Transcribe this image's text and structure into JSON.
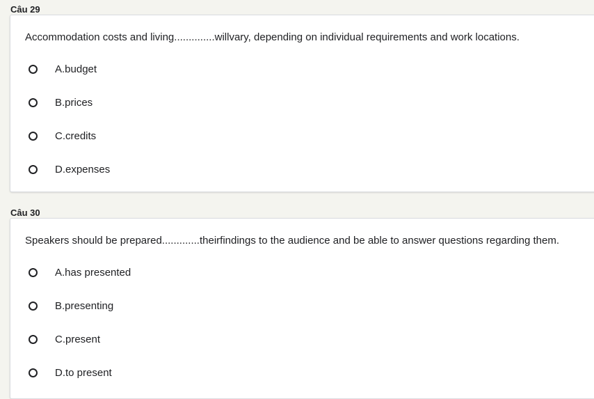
{
  "questions": [
    {
      "label": "Câu 29",
      "text": "Accommodation costs and living..............willvary, depending on individual requirements and work locations.",
      "options": [
        "A.budget",
        "B.prices",
        "C.credits",
        "D.expenses"
      ]
    },
    {
      "label": "Câu 30",
      "text": "Speakers should be prepared.............theirfindings to the audience and be able to answer questions regarding them.",
      "options": [
        "A.has presented",
        "B.presenting",
        "C.present",
        "D.to present"
      ]
    }
  ]
}
